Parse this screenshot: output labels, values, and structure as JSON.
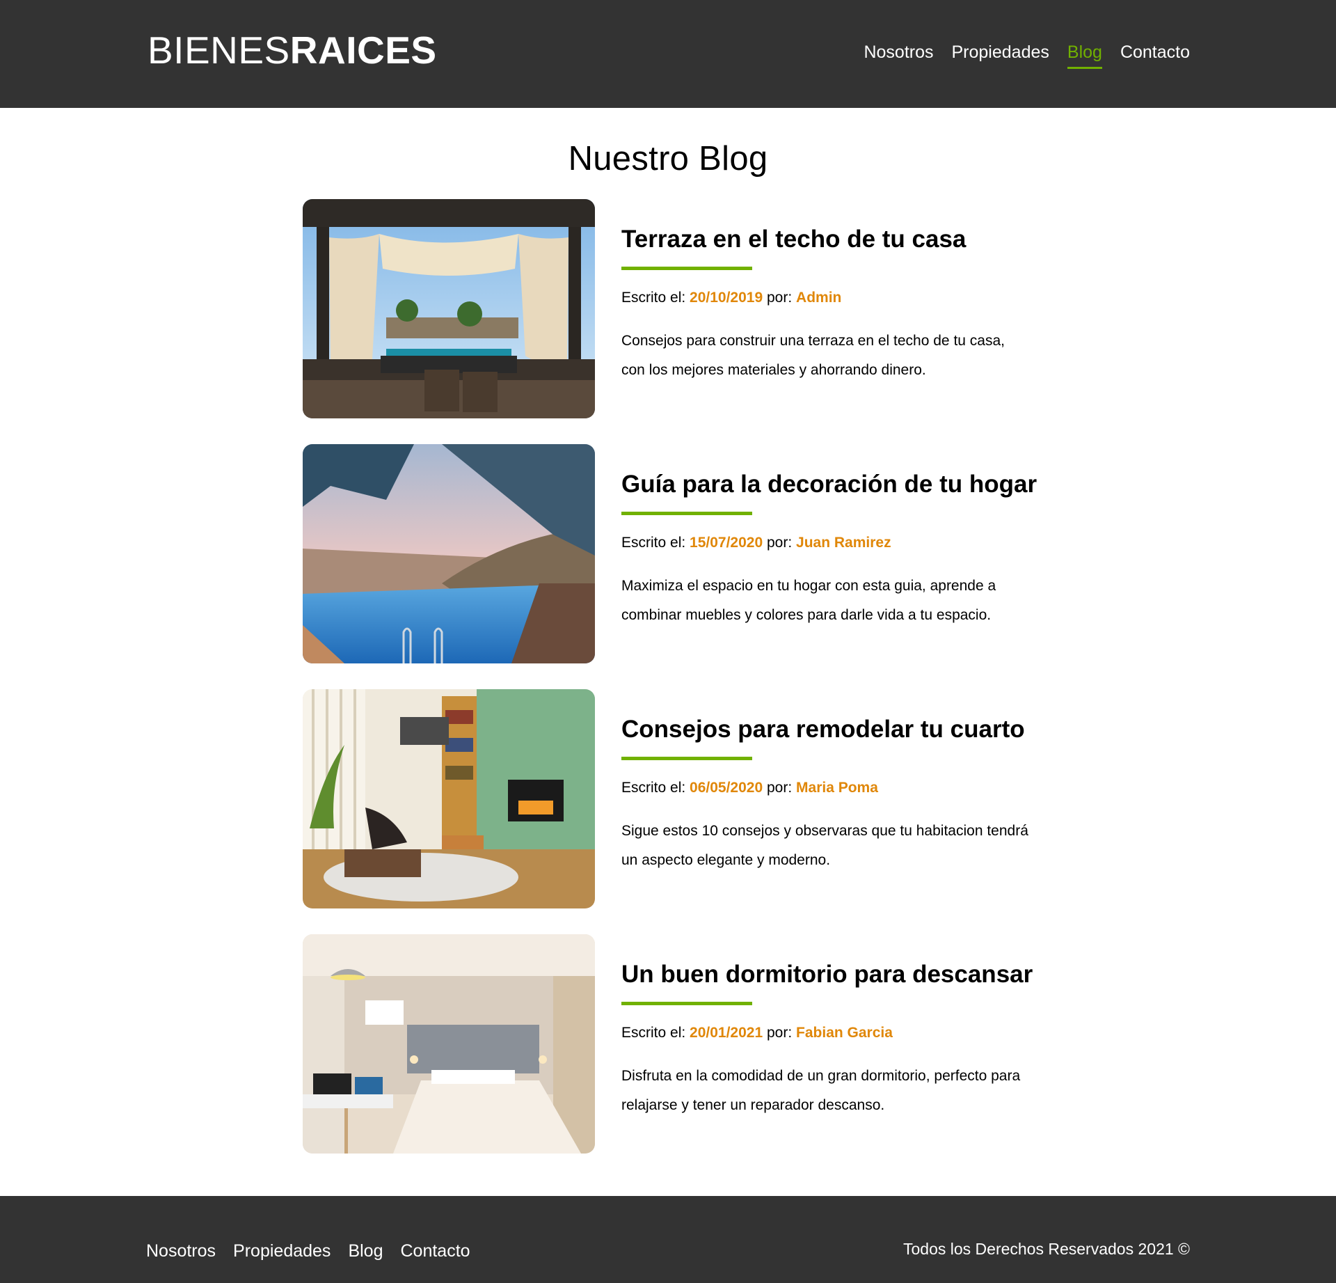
{
  "header": {
    "logo_light": "BIENES",
    "logo_bold": "RAICES",
    "nav": [
      "Nosotros",
      "Propiedades",
      "Blog",
      "Contacto"
    ],
    "active": "Blog"
  },
  "main": {
    "title": "Nuestro Blog",
    "entries": [
      {
        "title": "Terraza en el techo de tu casa",
        "written_label": "Escrito el:",
        "date": "20/10/2019",
        "by_label": "por:",
        "author": "Admin",
        "description": "Consejos para construir una terraza en el techo de tu casa, con los mejores materiales y ahorrando dinero."
      },
      {
        "title": "Guía para la decoración de tu hogar",
        "written_label": "Escrito el:",
        "date": "15/07/2020",
        "by_label": "por:",
        "author": "Juan Ramirez",
        "description": "Maximiza el espacio en tu hogar con esta guia, aprende a combinar muebles y colores para darle vida a tu espacio."
      },
      {
        "title": "Consejos para remodelar tu cuarto",
        "written_label": "Escrito el:",
        "date": "06/05/2020",
        "by_label": "por:",
        "author": "Maria Poma",
        "description": "Sigue estos 10 consejos y observaras que tu habitacion tendrá un aspecto elegante y moderno."
      },
      {
        "title": "Un buen dormitorio para descansar",
        "written_label": "Escrito el:",
        "date": "20/01/2021",
        "by_label": "por:",
        "author": "Fabian Garcia",
        "description": "Disfruta en la comodidad de un gran dormitorio, perfecto para relajarse y tener un reparador descanso."
      }
    ]
  },
  "footer": {
    "nav": [
      "Nosotros",
      "Propiedades",
      "Blog",
      "Contacto"
    ],
    "copyright": "Todos los Derechos Reservados 2021 ©"
  },
  "colors": {
    "dark": "#333333",
    "accent_green": "#71b100",
    "highlight_orange": "#e08709"
  }
}
